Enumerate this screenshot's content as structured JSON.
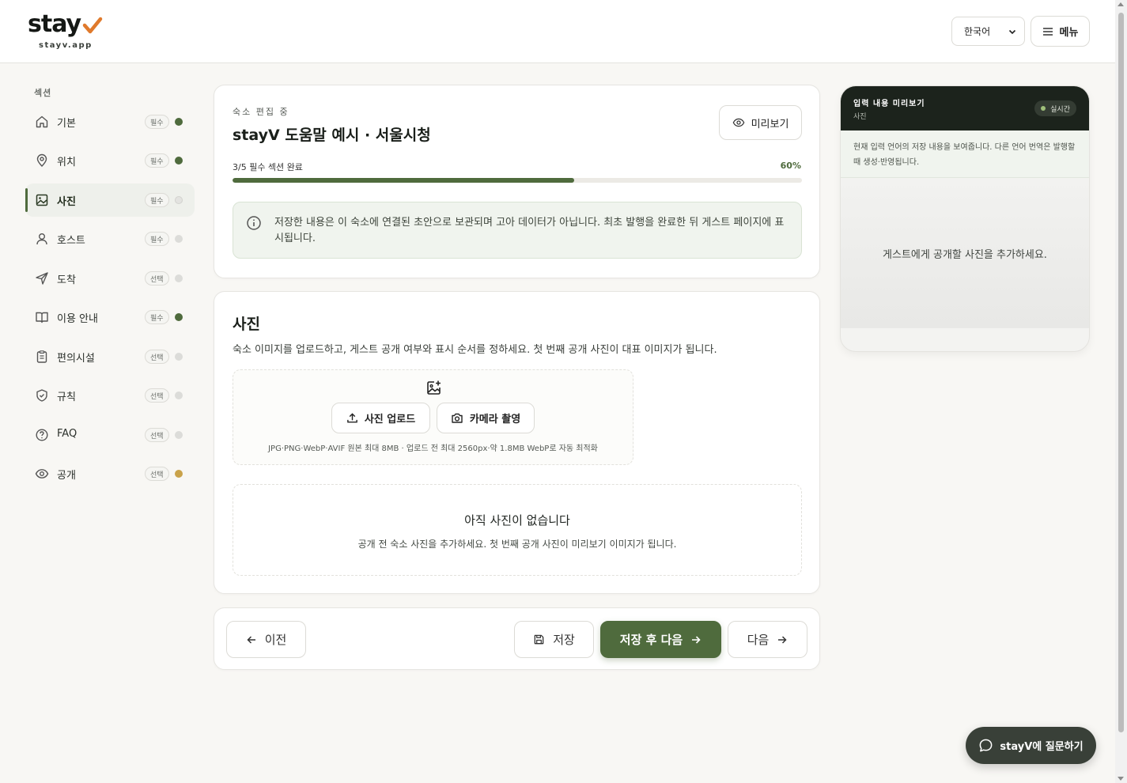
{
  "header": {
    "logo_text": "stay",
    "logo_sub": "stayv.app",
    "language": "한국어",
    "menu_label": "메뉴"
  },
  "sidebar": {
    "title": "섹션",
    "items": [
      {
        "label": "기본",
        "badge": "필수",
        "status": "complete",
        "icon": "home-icon"
      },
      {
        "label": "위치",
        "badge": "필수",
        "status": "complete",
        "icon": "map-pin-icon"
      },
      {
        "label": "사진",
        "badge": "필수",
        "status": "pending",
        "icon": "image-icon",
        "active": true
      },
      {
        "label": "호스트",
        "badge": "필수",
        "status": "pending",
        "icon": "user-icon"
      },
      {
        "label": "도착",
        "badge": "선택",
        "status": "pending",
        "icon": "send-icon"
      },
      {
        "label": "이용 안내",
        "badge": "필수",
        "status": "complete",
        "icon": "book-icon"
      },
      {
        "label": "편의시설",
        "badge": "선택",
        "status": "pending",
        "icon": "clipboard-icon"
      },
      {
        "label": "규칙",
        "badge": "선택",
        "status": "pending",
        "icon": "shield-icon"
      },
      {
        "label": "FAQ",
        "badge": "선택",
        "status": "pending",
        "icon": "help-circle-icon"
      },
      {
        "label": "공개",
        "badge": "선택",
        "status": "warning",
        "icon": "eye-icon"
      }
    ]
  },
  "main": {
    "editing_label": "숙소 편집 중",
    "listing_title": "stayV 도움말 예시 · 서울시청",
    "preview_button": "미리보기",
    "progress_label": "3/5 필수 섹션 완료",
    "progress_percent_text": "60%",
    "progress_value": 0.6,
    "notice": "저장한 내용은 이 숙소에 연결된 초안으로 보관되며 고아 데이터가 아닙니다. 최초 발행을 완료한 뒤 게스트 페이지에 표시됩니다.",
    "photos": {
      "title": "사진",
      "description": "숙소 이미지를 업로드하고, 게스트 공개 여부와 표시 순서를 정하세요. 첫 번째 공개 사진이 대표 이미지가 됩니다.",
      "upload_button": "사진 업로드",
      "camera_button": "카메라 촬영",
      "upload_hint": "JPG·PNG·WebP·AVIF 원본 최대 8MB · 업로드 전 최대 2560px·약 1.8MB WebP로 자동 최적화",
      "empty_title": "아직 사진이 없습니다",
      "empty_desc": "공개 전 숙소 사진을 추가하세요. 첫 번째 공개 사진이 미리보기 이미지가 됩니다."
    },
    "nav": {
      "prev": "이전",
      "save": "저장",
      "save_next": "저장 후 다음",
      "next": "다음"
    }
  },
  "preview_panel": {
    "title": "입력 내용 미리보기",
    "subtitle": "사진",
    "live_badge": "실시간",
    "note": "현재 입력 언어의 저장 내용을 보여줍니다. 다른 언어 번역은 발행할 때 생성·반영됩니다.",
    "empty_text": "게스트에게 공개할 사진을 추가하세요."
  },
  "chat_button": "stayV에 질문하기",
  "colors": {
    "accent": "#4f6b3d",
    "status_complete": "#4f6b3d",
    "status_pending": "#d9d9d6",
    "status_warning": "#c9a24a",
    "logo_check": "#e07a2c"
  }
}
